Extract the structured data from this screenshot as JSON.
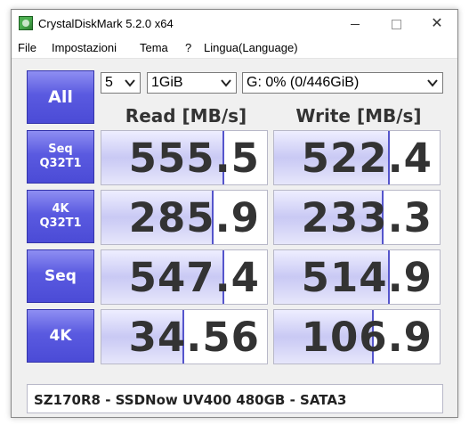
{
  "window": {
    "title": "CrystalDiskMark 5.2.0 x64",
    "controls": {
      "minimize_icon": "minimize-icon",
      "maximize_icon": "maximize-icon",
      "close_icon": "close-icon"
    }
  },
  "menu": [
    "File",
    "Impostazioni",
    "Tema",
    "?",
    "Lingua(Language)"
  ],
  "toolbar": {
    "all_label": "All",
    "test_count": "5",
    "test_size": "1GiB",
    "drive": "G: 0% (0/446GiB)"
  },
  "columns": {
    "read": "Read [MB/s]",
    "write": "Write [MB/s]"
  },
  "rows": [
    {
      "label_line1": "Seq",
      "label_line2": "Q32T1",
      "read": "555.5",
      "write": "522.4",
      "read_fill": 0.74,
      "write_fill": 0.7
    },
    {
      "label_line1": "4K",
      "label_line2": "Q32T1",
      "read": "285.9",
      "write": "233.3",
      "read_fill": 0.68,
      "write_fill": 0.66
    },
    {
      "label_line1": "Seq",
      "label_line2": "",
      "read": "547.4",
      "write": "514.9",
      "read_fill": 0.74,
      "write_fill": 0.7
    },
    {
      "label_line1": "4K",
      "label_line2": "",
      "read": "34.56",
      "write": "106.9",
      "read_fill": 0.5,
      "write_fill": 0.6
    }
  ],
  "comment": "SZ170R8 - SSDNow UV400 480GB - SATA3",
  "colors": {
    "button_blue": "#5a5ae0",
    "fill_blue": "#c9c9f4",
    "fill_edge": "#5555cc"
  }
}
